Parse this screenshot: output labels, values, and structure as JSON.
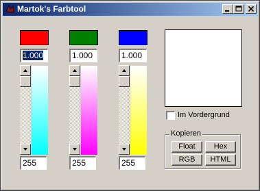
{
  "window": {
    "title": "Martok's Farbtool",
    "minimize_icon": "minimize-icon",
    "maximize_icon": "maximize-icon",
    "close_icon": "close-icon"
  },
  "channels": [
    {
      "swatch_color": "#ff0000",
      "float_value": "1.000",
      "int_value": "255",
      "slider_level": 1.0,
      "gradient": [
        "#ffffff",
        "#00ffff"
      ]
    },
    {
      "swatch_color": "#008000",
      "float_value": "1.000",
      "int_value": "255",
      "slider_level": 1.0,
      "gradient": [
        "#ffffff",
        "#ff00ff"
      ]
    },
    {
      "swatch_color": "#0000ff",
      "float_value": "1.000",
      "int_value": "255",
      "slider_level": 1.0,
      "gradient": [
        "#ffffff",
        "#ffff00"
      ]
    }
  ],
  "preview": {
    "color": "#ffffff"
  },
  "options": {
    "foreground_label": "Im Vordergrund",
    "foreground_checked": false
  },
  "copy_group": {
    "label": "Kopieren",
    "buttons": {
      "float": "Float",
      "hex": "Hex",
      "rgb": "RGB",
      "html": "HTML"
    }
  }
}
